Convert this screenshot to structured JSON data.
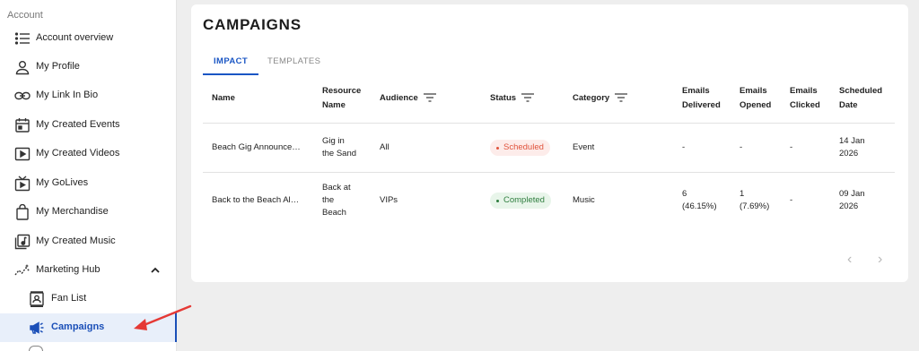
{
  "sidebar": {
    "section_label": "Account",
    "items": [
      {
        "label": "Account overview",
        "icon": "list-icon"
      },
      {
        "label": "My Profile",
        "icon": "person-icon"
      },
      {
        "label": "My Link In Bio",
        "icon": "link-icon"
      },
      {
        "label": "My Created Events",
        "icon": "calendar-icon"
      },
      {
        "label": "My Created Videos",
        "icon": "video-icon"
      },
      {
        "label": "My GoLives",
        "icon": "tv-icon"
      },
      {
        "label": "My Merchandise",
        "icon": "bag-icon"
      },
      {
        "label": "My Created Music",
        "icon": "music-icon"
      },
      {
        "label": "Marketing Hub",
        "icon": "sparkline-icon",
        "expanded": true
      }
    ],
    "sub_items": [
      {
        "label": "Fan List",
        "icon": "contact-card-icon"
      },
      {
        "label": "Campaigns",
        "icon": "megaphone-icon",
        "active": true
      }
    ]
  },
  "main": {
    "title": "CAMPAIGNS",
    "tabs": [
      {
        "label": "IMPACT",
        "active": true
      },
      {
        "label": "TEMPLATES",
        "active": false
      }
    ],
    "table": {
      "columns": [
        {
          "line1": "Name",
          "line2": "",
          "filter": false
        },
        {
          "line1": "Resource",
          "line2": "Name",
          "filter": false
        },
        {
          "line1": "Audience",
          "line2": "",
          "filter": true
        },
        {
          "line1": "Status",
          "line2": "",
          "filter": true
        },
        {
          "line1": "Category",
          "line2": "",
          "filter": true
        },
        {
          "line1": "Emails",
          "line2": "Delivered",
          "filter": false
        },
        {
          "line1": "Emails",
          "line2": "Opened",
          "filter": false
        },
        {
          "line1": "Emails",
          "line2": "Clicked",
          "filter": false
        },
        {
          "line1": "Scheduled",
          "line2": "Date",
          "filter": false
        }
      ],
      "rows": [
        {
          "name": "Beach Gig Announce…",
          "resource": [
            "Gig in",
            "the Sand"
          ],
          "audience": "All",
          "status": "Scheduled",
          "category": "Event",
          "delivered": [
            "-",
            ""
          ],
          "opened": [
            "-",
            ""
          ],
          "clicked": "-",
          "date": [
            "14 Jan",
            "2026"
          ]
        },
        {
          "name": "Back to the Beach Al…",
          "resource": [
            "Back at",
            "the",
            "Beach"
          ],
          "audience": "VIPs",
          "status": "Completed",
          "category": "Music",
          "delivered": [
            "6",
            "(46.15%)"
          ],
          "opened": [
            "1",
            "(7.69%)"
          ],
          "clicked": "-",
          "date": [
            "09 Jan",
            "2026"
          ]
        }
      ]
    },
    "pagination": {
      "prev": "‹",
      "next": "›"
    }
  },
  "colors": {
    "accent": "#1a56c4",
    "scheduled": "#e0533c",
    "completed": "#2e7d3e",
    "annotation_arrow": "#e53935"
  }
}
